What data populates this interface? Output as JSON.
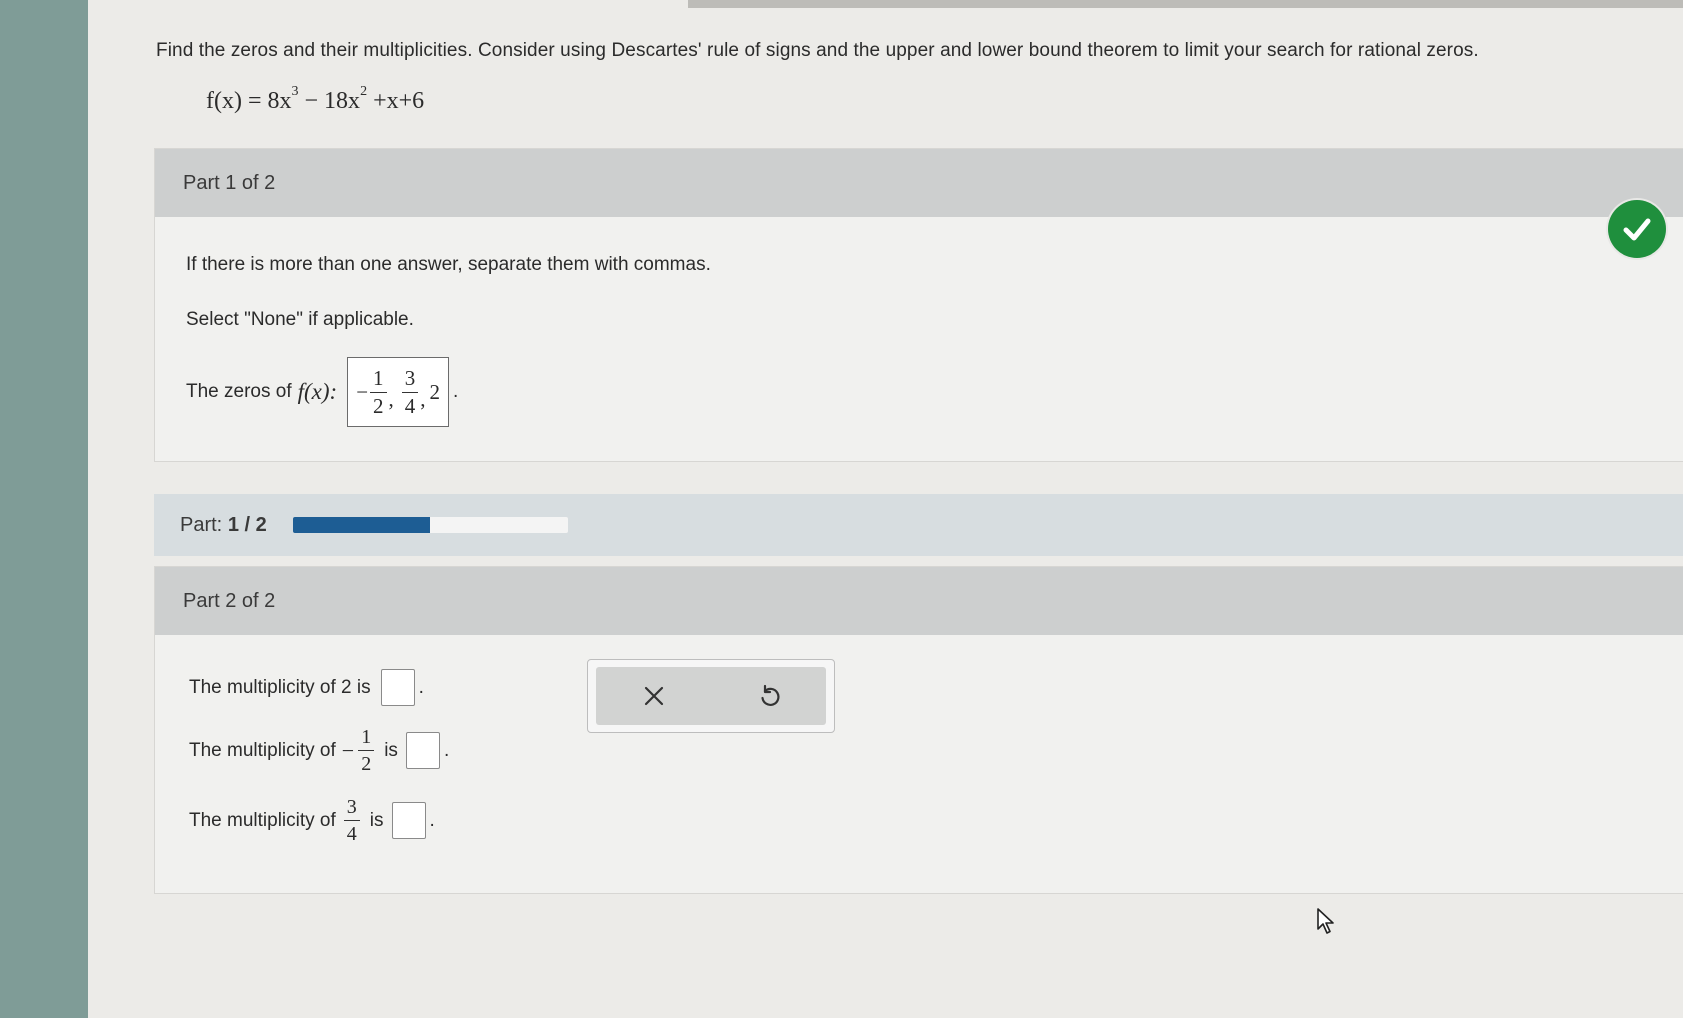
{
  "question": {
    "prompt": "Find the zeros and their multiplicities. Consider using Descartes' rule of signs and the upper and lower bound theorem to limit your search for rational zeros.",
    "function_lhs": "f(x) = 8x",
    "exp1": "3",
    "mid": " − 18x",
    "exp2": "2",
    "tail": " +x+6"
  },
  "part1": {
    "header": "Part 1 of 2",
    "hint_commas": "If there is more than one answer, separate them with commas.",
    "hint_none": "Select \"None\" if applicable.",
    "zeros_label": "The zeros of",
    "fx_label": "f(x):",
    "answer": {
      "neg_sign": "−",
      "frac1_num": "1",
      "frac1_den": "2",
      "sep1": ",",
      "frac2_num": "3",
      "frac2_den": "4",
      "sep2": ",",
      "last": "2"
    },
    "status": "correct"
  },
  "progress": {
    "label": "Part:",
    "value": "1 / 2",
    "fraction": 0.5
  },
  "part2": {
    "header": "Part 2 of 2",
    "row1": {
      "prefix": "The multiplicity of 2 is",
      "suffix": "."
    },
    "row2": {
      "prefix": "The multiplicity of",
      "sign": "−",
      "num": "1",
      "den": "2",
      "is": "is",
      "suffix": "."
    },
    "row3": {
      "prefix": "The multiplicity of",
      "num": "3",
      "den": "4",
      "is": "is",
      "suffix": "."
    }
  },
  "toolbar": {
    "clear_icon": "close-icon",
    "undo_icon": "undo-icon"
  },
  "colors": {
    "check": "#1f8f3d",
    "progress_fill": "#1d5d94"
  }
}
